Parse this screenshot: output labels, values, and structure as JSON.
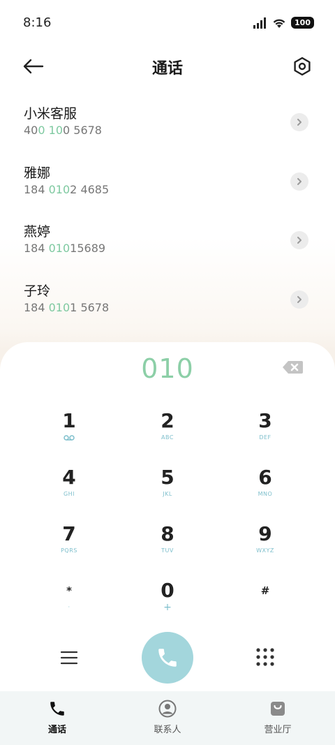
{
  "status_bar": {
    "time": "8:16",
    "battery": "100",
    "icons": [
      "signal-icon",
      "wifi-icon",
      "battery-icon"
    ]
  },
  "header": {
    "title": "通话",
    "back_icon": "arrow-left-icon",
    "settings_icon": "hexagon-gear-icon"
  },
  "results": [
    {
      "name": "小米客服",
      "num_a": "40",
      "num_hl1": "0",
      "num_b": " ",
      "num_hl2": "10",
      "num_c": "0 5678"
    },
    {
      "name": "雅娜",
      "num_a": "184 ",
      "num_hl1": "010",
      "num_b": "",
      "num_hl2": "",
      "num_c": "2 4685"
    },
    {
      "name": "燕婷",
      "num_a": "184 ",
      "num_hl1": "010",
      "num_b": "",
      "num_hl2": "",
      "num_c": "15689"
    },
    {
      "name": "子玲",
      "num_a": "184 ",
      "num_hl1": "010",
      "num_b": "",
      "num_hl2": "",
      "num_c": "1 5678"
    }
  ],
  "dialpad": {
    "input": "010",
    "keys": [
      {
        "digit": "1",
        "sub": "voicemail-icon"
      },
      {
        "digit": "2",
        "sub": "ABC"
      },
      {
        "digit": "3",
        "sub": "DEF"
      },
      {
        "digit": "4",
        "sub": "GHI"
      },
      {
        "digit": "5",
        "sub": "JKL"
      },
      {
        "digit": "6",
        "sub": "MNO"
      },
      {
        "digit": "7",
        "sub": "PQRS"
      },
      {
        "digit": "8",
        "sub": "TUV"
      },
      {
        "digit": "9",
        "sub": "WXYZ"
      },
      {
        "digit": "*",
        "sub": "·"
      },
      {
        "digit": "0",
        "sub": "+"
      },
      {
        "digit": "#",
        "sub": ""
      }
    ]
  },
  "tabs": [
    {
      "label": "通话",
      "icon": "phone-icon",
      "active": true
    },
    {
      "label": "联系人",
      "icon": "person-icon",
      "active": false
    },
    {
      "label": "营业厅",
      "icon": "shopping-bag-icon",
      "active": false
    }
  ],
  "colors": {
    "highlight": "#7ec9a0",
    "call_button": "#a3d6dc",
    "key_sub": "#7ebfcc"
  }
}
